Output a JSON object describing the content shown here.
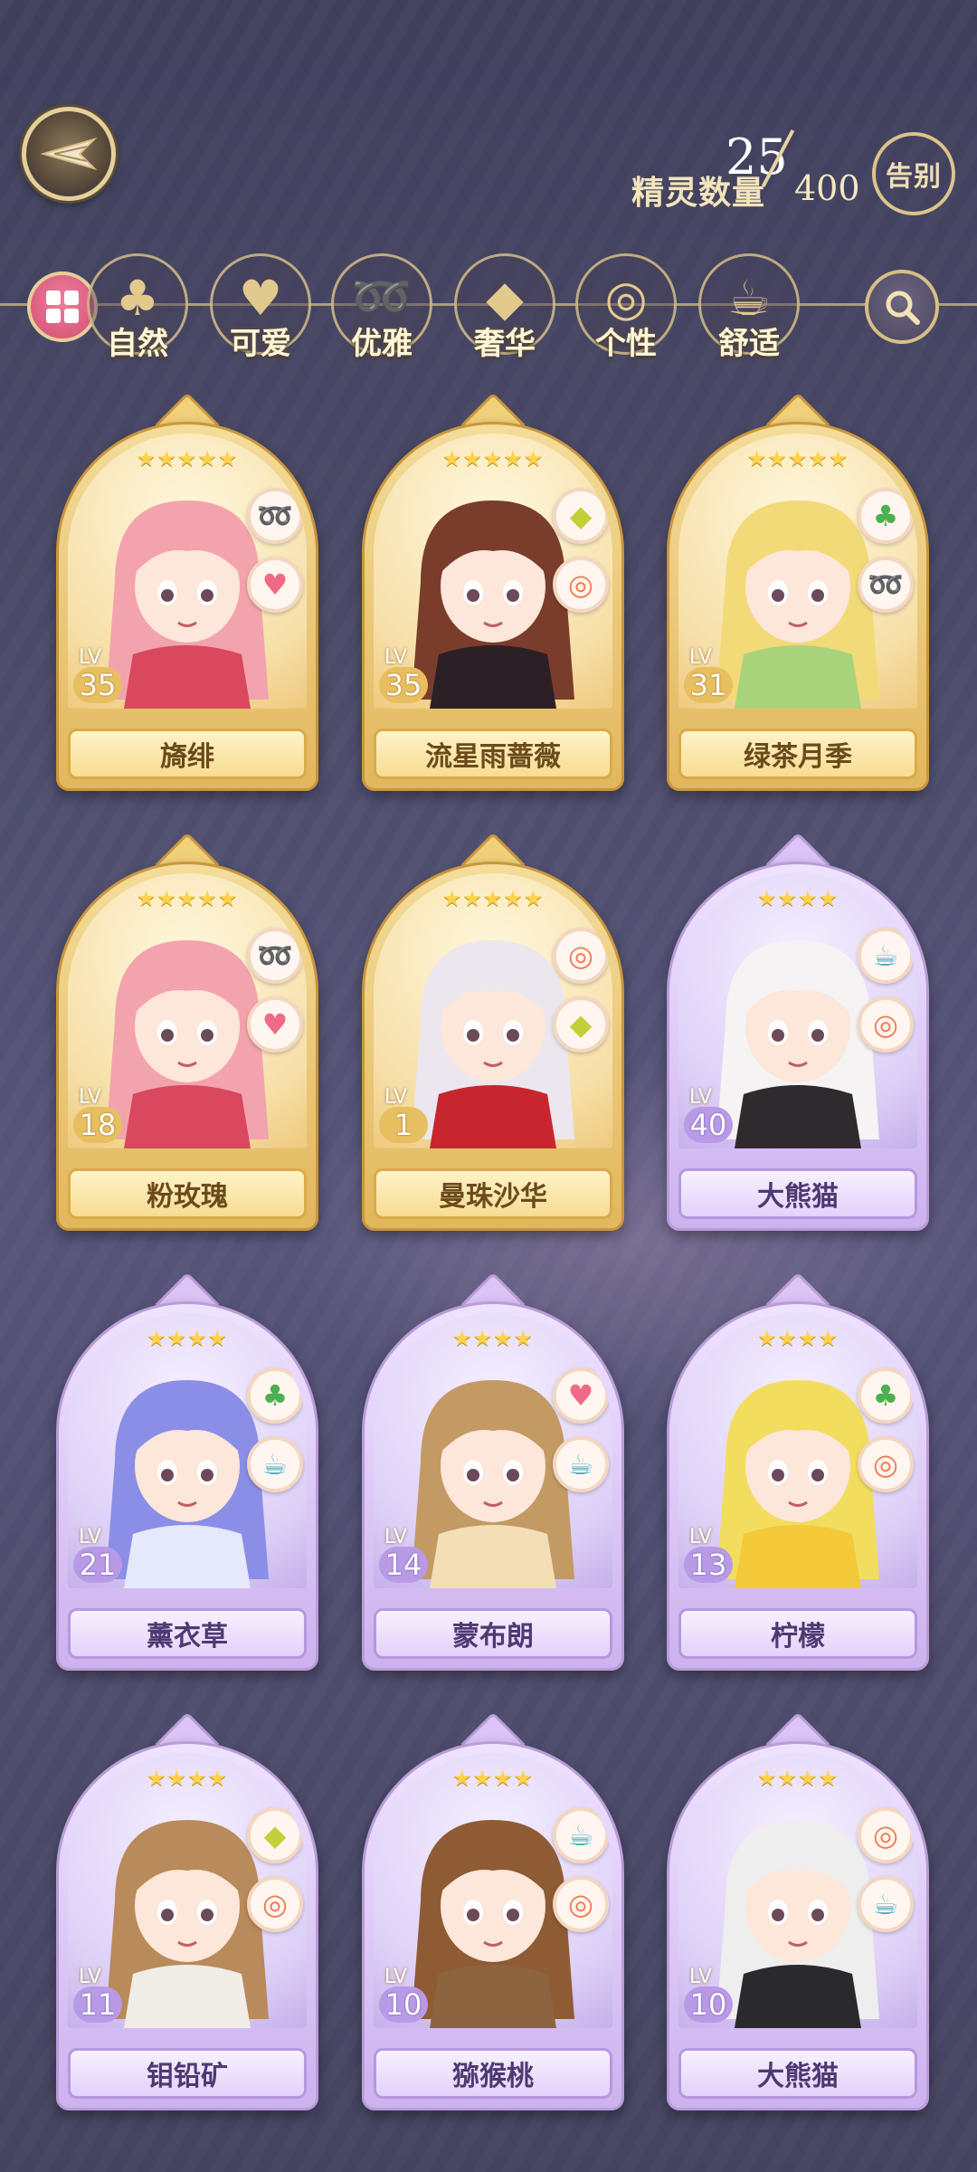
{
  "header": {
    "count_label": "精灵数量",
    "count_current": "25",
    "count_max": "400",
    "farewell_label": "告别"
  },
  "categories": [
    {
      "label": "自然",
      "icon": "clover-icon"
    },
    {
      "label": "可爱",
      "icon": "heart-icon"
    },
    {
      "label": "优雅",
      "icon": "swan-icon"
    },
    {
      "label": "奢华",
      "icon": "diamond-icon"
    },
    {
      "label": "个性",
      "icon": "glasses-icon"
    },
    {
      "label": "舒适",
      "icon": "teacup-icon"
    }
  ],
  "spirits": [
    {
      "name": "旖绯",
      "level": "35",
      "stars": "★★★★★",
      "tier": "gold",
      "traits": [
        "swan-icon",
        "heart-icon"
      ],
      "colors": {
        "hair": "#f3a3ad",
        "cloth": "#d9485c"
      }
    },
    {
      "name": "流星雨蔷薇",
      "level": "35",
      "stars": "★★★★★",
      "tier": "gold",
      "traits": [
        "diamond-icon",
        "glasses-icon"
      ],
      "colors": {
        "hair": "#7a3d2b",
        "cloth": "#2b2026"
      }
    },
    {
      "name": "绿茶月季",
      "level": "31",
      "stars": "★★★★★",
      "tier": "gold",
      "traits": [
        "clover-icon",
        "swan-icon"
      ],
      "colors": {
        "hair": "#f3da78",
        "cloth": "#a9d37a"
      }
    },
    {
      "name": "粉玫瑰",
      "level": "18",
      "stars": "★★★★★",
      "tier": "gold",
      "traits": [
        "swan-icon",
        "heart-icon"
      ],
      "colors": {
        "hair": "#f3a3ad",
        "cloth": "#d9485c"
      }
    },
    {
      "name": "曼珠沙华",
      "level": "1",
      "stars": "★★★★★",
      "tier": "gold",
      "traits": [
        "glasses-icon",
        "diamond-icon"
      ],
      "colors": {
        "hair": "#ece6ef",
        "cloth": "#c8262f"
      }
    },
    {
      "name": "大熊猫",
      "level": "40",
      "stars": "★★★★",
      "tier": "purple",
      "traits": [
        "teacup-icon",
        "glasses-icon"
      ],
      "colors": {
        "hair": "#f5f3f3",
        "cloth": "#2e2a2e"
      }
    },
    {
      "name": "薰衣草",
      "level": "21",
      "stars": "★★★★",
      "tier": "purple",
      "traits": [
        "clover-icon",
        "teacup-icon"
      ],
      "colors": {
        "hair": "#8b8ee6",
        "cloth": "#e6e8fb"
      }
    },
    {
      "name": "蒙布朗",
      "level": "14",
      "stars": "★★★★",
      "tier": "purple",
      "traits": [
        "heart-icon",
        "teacup-icon"
      ],
      "colors": {
        "hair": "#c49a64",
        "cloth": "#f2dfb6"
      }
    },
    {
      "name": "柠檬",
      "level": "13",
      "stars": "★★★★",
      "tier": "purple",
      "traits": [
        "clover-icon",
        "glasses-icon"
      ],
      "colors": {
        "hair": "#f3dd5e",
        "cloth": "#f4c93a"
      }
    },
    {
      "name": "钼铅矿",
      "level": "11",
      "stars": "★★★★",
      "tier": "purple",
      "traits": [
        "diamond-icon",
        "glasses-icon"
      ],
      "colors": {
        "hair": "#b98a5a",
        "cloth": "#f0ece6"
      }
    },
    {
      "name": "猕猴桃",
      "level": "10",
      "stars": "★★★★",
      "tier": "purple",
      "traits": [
        "teacup-icon",
        "glasses-icon"
      ],
      "colors": {
        "hair": "#8e5b34",
        "cloth": "#8d6440"
      }
    },
    {
      "name": "大熊猫",
      "level": "10",
      "stars": "★★★★",
      "tier": "purple",
      "traits": [
        "glasses-icon",
        "teacup-icon"
      ],
      "colors": {
        "hair": "#efeeee",
        "cloth": "#2a2a2e"
      }
    }
  ]
}
